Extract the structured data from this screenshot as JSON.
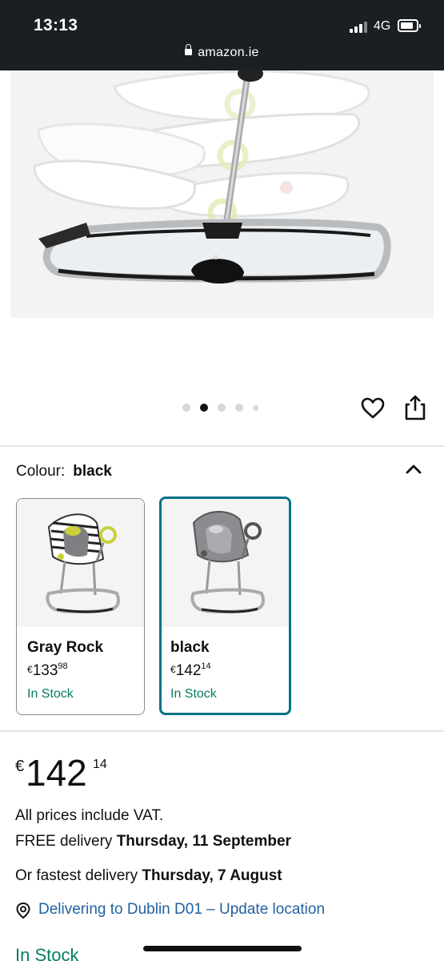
{
  "status_bar": {
    "time": "13:13",
    "network": "4G",
    "url": "amazon.ie"
  },
  "gallery": {
    "image_count": 5,
    "active_index": 1,
    "icons": [
      "heart-icon",
      "share-icon"
    ]
  },
  "colour": {
    "label": "Colour:",
    "selected": "black",
    "options": [
      {
        "name": "Gray Rock",
        "currency": "€",
        "whole": "133",
        "fraction": "98",
        "stock": "In Stock",
        "selected": false
      },
      {
        "name": "black",
        "currency": "€",
        "whole": "142",
        "fraction": "14",
        "stock": "In Stock",
        "selected": true
      }
    ]
  },
  "price": {
    "currency": "€",
    "whole": "142",
    "fraction": "14"
  },
  "info": {
    "vat": "All prices include VAT.",
    "delivery_prefix": "FREE delivery",
    "delivery_date": "Thursday, 11 September",
    "fastest_prefix": "Or fastest delivery",
    "fastest_date": "Thursday, 7 August",
    "location_link": "Delivering to Dublin D01 – Update location",
    "stock": "In Stock"
  },
  "colors": {
    "link": "#2162a1",
    "stock_green": "#067d62",
    "selected_border": "#007185",
    "status_bar": "#1b1f23"
  }
}
